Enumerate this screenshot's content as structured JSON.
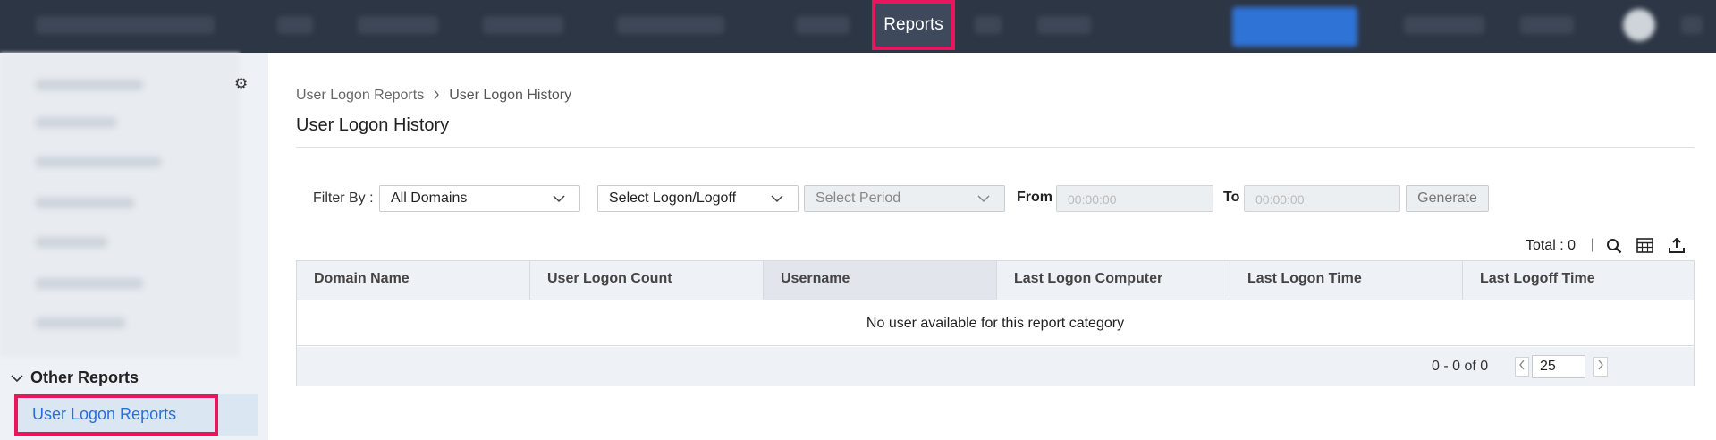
{
  "header": {
    "active_tab": "Reports"
  },
  "sidebar": {
    "section_title": "Other Reports",
    "selected_item": "User Logon Reports"
  },
  "breadcrumb": {
    "parent": "User Logon Reports",
    "current": "User Logon History"
  },
  "page_title": "User Logon History",
  "filters": {
    "filter_by_label": "Filter By :",
    "domain_select": "All Domains",
    "logon_select": "Select Logon/Logoff",
    "period_select": "Select Period",
    "from_label": "From",
    "from_placeholder": "00:00:00",
    "to_label": "To",
    "to_placeholder": "00:00:00",
    "generate_label": "Generate"
  },
  "toolbar": {
    "total_text": "Total : 0",
    "divider": "|"
  },
  "table": {
    "columns": [
      "Domain Name",
      "User Logon Count",
      "Username",
      "Last Logon Computer",
      "Last Logon Time",
      "Last Logoff Time"
    ],
    "sorted_column": "Username",
    "empty_message": "No user available for this report category"
  },
  "pagination": {
    "range_text": "0 - 0 of 0",
    "page_size": "25"
  }
}
